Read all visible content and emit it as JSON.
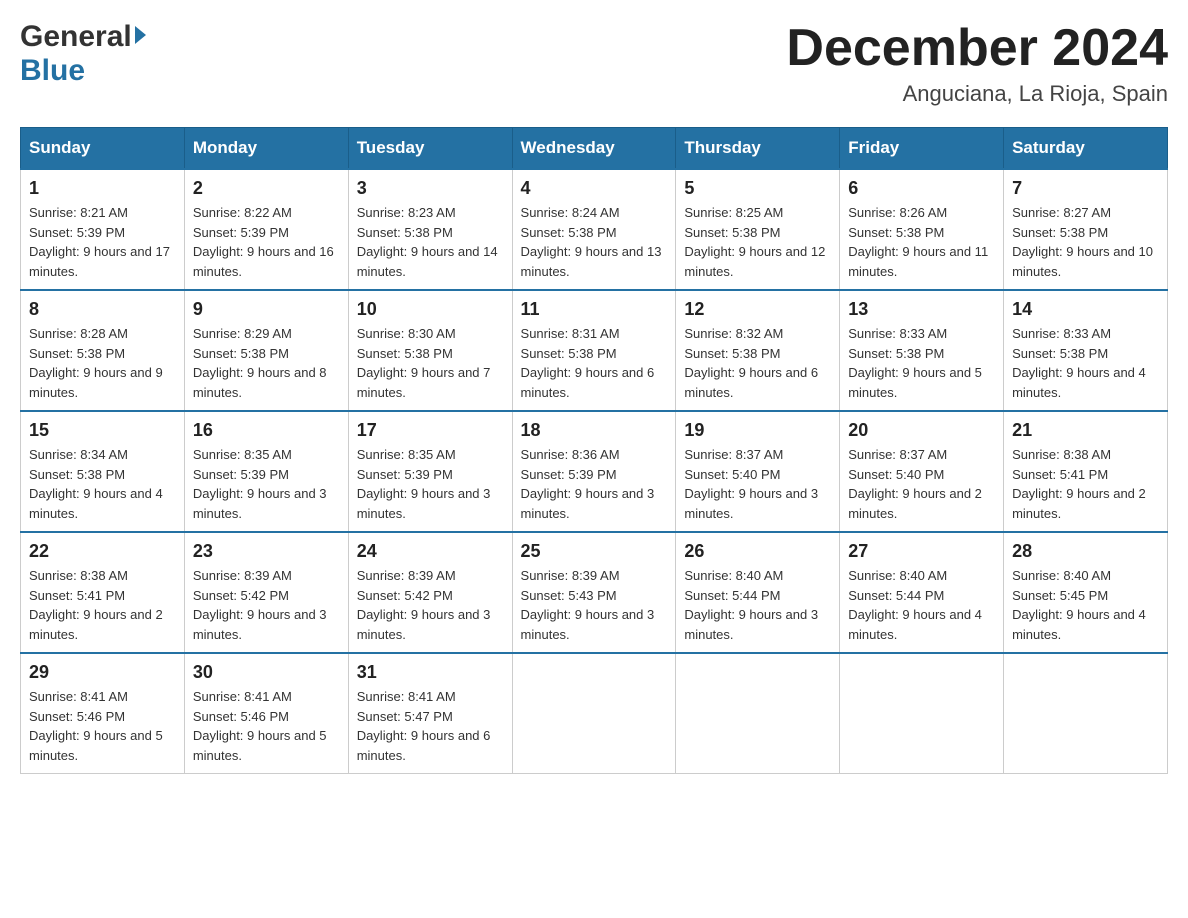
{
  "logo": {
    "general": "General",
    "blue": "Blue"
  },
  "header": {
    "title": "December 2024",
    "subtitle": "Anguciana, La Rioja, Spain"
  },
  "weekdays": [
    "Sunday",
    "Monday",
    "Tuesday",
    "Wednesday",
    "Thursday",
    "Friday",
    "Saturday"
  ],
  "weeks": [
    [
      {
        "day": "1",
        "sunrise": "Sunrise: 8:21 AM",
        "sunset": "Sunset: 5:39 PM",
        "daylight": "Daylight: 9 hours and 17 minutes."
      },
      {
        "day": "2",
        "sunrise": "Sunrise: 8:22 AM",
        "sunset": "Sunset: 5:39 PM",
        "daylight": "Daylight: 9 hours and 16 minutes."
      },
      {
        "day": "3",
        "sunrise": "Sunrise: 8:23 AM",
        "sunset": "Sunset: 5:38 PM",
        "daylight": "Daylight: 9 hours and 14 minutes."
      },
      {
        "day": "4",
        "sunrise": "Sunrise: 8:24 AM",
        "sunset": "Sunset: 5:38 PM",
        "daylight": "Daylight: 9 hours and 13 minutes."
      },
      {
        "day": "5",
        "sunrise": "Sunrise: 8:25 AM",
        "sunset": "Sunset: 5:38 PM",
        "daylight": "Daylight: 9 hours and 12 minutes."
      },
      {
        "day": "6",
        "sunrise": "Sunrise: 8:26 AM",
        "sunset": "Sunset: 5:38 PM",
        "daylight": "Daylight: 9 hours and 11 minutes."
      },
      {
        "day": "7",
        "sunrise": "Sunrise: 8:27 AM",
        "sunset": "Sunset: 5:38 PM",
        "daylight": "Daylight: 9 hours and 10 minutes."
      }
    ],
    [
      {
        "day": "8",
        "sunrise": "Sunrise: 8:28 AM",
        "sunset": "Sunset: 5:38 PM",
        "daylight": "Daylight: 9 hours and 9 minutes."
      },
      {
        "day": "9",
        "sunrise": "Sunrise: 8:29 AM",
        "sunset": "Sunset: 5:38 PM",
        "daylight": "Daylight: 9 hours and 8 minutes."
      },
      {
        "day": "10",
        "sunrise": "Sunrise: 8:30 AM",
        "sunset": "Sunset: 5:38 PM",
        "daylight": "Daylight: 9 hours and 7 minutes."
      },
      {
        "day": "11",
        "sunrise": "Sunrise: 8:31 AM",
        "sunset": "Sunset: 5:38 PM",
        "daylight": "Daylight: 9 hours and 6 minutes."
      },
      {
        "day": "12",
        "sunrise": "Sunrise: 8:32 AM",
        "sunset": "Sunset: 5:38 PM",
        "daylight": "Daylight: 9 hours and 6 minutes."
      },
      {
        "day": "13",
        "sunrise": "Sunrise: 8:33 AM",
        "sunset": "Sunset: 5:38 PM",
        "daylight": "Daylight: 9 hours and 5 minutes."
      },
      {
        "day": "14",
        "sunrise": "Sunrise: 8:33 AM",
        "sunset": "Sunset: 5:38 PM",
        "daylight": "Daylight: 9 hours and 4 minutes."
      }
    ],
    [
      {
        "day": "15",
        "sunrise": "Sunrise: 8:34 AM",
        "sunset": "Sunset: 5:38 PM",
        "daylight": "Daylight: 9 hours and 4 minutes."
      },
      {
        "day": "16",
        "sunrise": "Sunrise: 8:35 AM",
        "sunset": "Sunset: 5:39 PM",
        "daylight": "Daylight: 9 hours and 3 minutes."
      },
      {
        "day": "17",
        "sunrise": "Sunrise: 8:35 AM",
        "sunset": "Sunset: 5:39 PM",
        "daylight": "Daylight: 9 hours and 3 minutes."
      },
      {
        "day": "18",
        "sunrise": "Sunrise: 8:36 AM",
        "sunset": "Sunset: 5:39 PM",
        "daylight": "Daylight: 9 hours and 3 minutes."
      },
      {
        "day": "19",
        "sunrise": "Sunrise: 8:37 AM",
        "sunset": "Sunset: 5:40 PM",
        "daylight": "Daylight: 9 hours and 3 minutes."
      },
      {
        "day": "20",
        "sunrise": "Sunrise: 8:37 AM",
        "sunset": "Sunset: 5:40 PM",
        "daylight": "Daylight: 9 hours and 2 minutes."
      },
      {
        "day": "21",
        "sunrise": "Sunrise: 8:38 AM",
        "sunset": "Sunset: 5:41 PM",
        "daylight": "Daylight: 9 hours and 2 minutes."
      }
    ],
    [
      {
        "day": "22",
        "sunrise": "Sunrise: 8:38 AM",
        "sunset": "Sunset: 5:41 PM",
        "daylight": "Daylight: 9 hours and 2 minutes."
      },
      {
        "day": "23",
        "sunrise": "Sunrise: 8:39 AM",
        "sunset": "Sunset: 5:42 PM",
        "daylight": "Daylight: 9 hours and 3 minutes."
      },
      {
        "day": "24",
        "sunrise": "Sunrise: 8:39 AM",
        "sunset": "Sunset: 5:42 PM",
        "daylight": "Daylight: 9 hours and 3 minutes."
      },
      {
        "day": "25",
        "sunrise": "Sunrise: 8:39 AM",
        "sunset": "Sunset: 5:43 PM",
        "daylight": "Daylight: 9 hours and 3 minutes."
      },
      {
        "day": "26",
        "sunrise": "Sunrise: 8:40 AM",
        "sunset": "Sunset: 5:44 PM",
        "daylight": "Daylight: 9 hours and 3 minutes."
      },
      {
        "day": "27",
        "sunrise": "Sunrise: 8:40 AM",
        "sunset": "Sunset: 5:44 PM",
        "daylight": "Daylight: 9 hours and 4 minutes."
      },
      {
        "day": "28",
        "sunrise": "Sunrise: 8:40 AM",
        "sunset": "Sunset: 5:45 PM",
        "daylight": "Daylight: 9 hours and 4 minutes."
      }
    ],
    [
      {
        "day": "29",
        "sunrise": "Sunrise: 8:41 AM",
        "sunset": "Sunset: 5:46 PM",
        "daylight": "Daylight: 9 hours and 5 minutes."
      },
      {
        "day": "30",
        "sunrise": "Sunrise: 8:41 AM",
        "sunset": "Sunset: 5:46 PM",
        "daylight": "Daylight: 9 hours and 5 minutes."
      },
      {
        "day": "31",
        "sunrise": "Sunrise: 8:41 AM",
        "sunset": "Sunset: 5:47 PM",
        "daylight": "Daylight: 9 hours and 6 minutes."
      },
      null,
      null,
      null,
      null
    ]
  ]
}
